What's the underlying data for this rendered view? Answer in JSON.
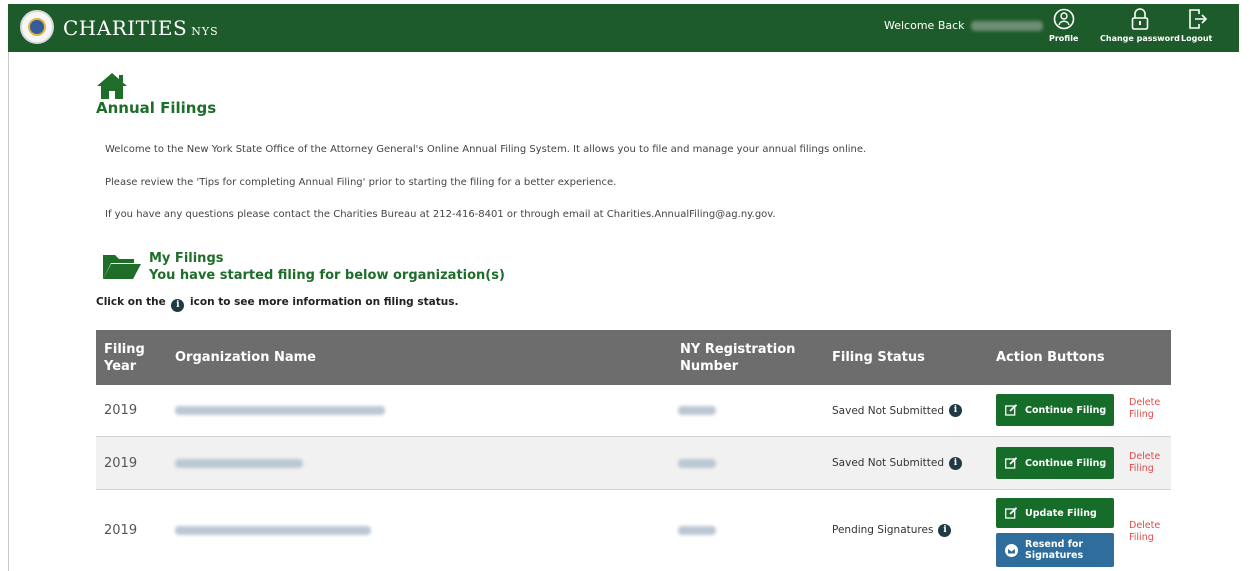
{
  "header": {
    "brand": "CHARITIES",
    "brand_sub": "NYS",
    "welcome": "Welcome Back",
    "nav": [
      {
        "label": "Profile",
        "icon": "profile-icon"
      },
      {
        "label": "Change password",
        "icon": "lock-icon"
      },
      {
        "label": "Logout",
        "icon": "logout-icon"
      }
    ]
  },
  "page": {
    "title": "Annual Filings",
    "paragraphs": [
      "Welcome to the New York State Office of the Attorney General's Online Annual Filing System. It allows you to file and manage your annual filings online.",
      "Please review the 'Tips for completing Annual Filing' prior to starting the filing for a better experience.",
      "If you have any questions please contact the Charities Bureau at 212-416-8401 or through email at Charities.AnnualFiling@ag.ny.gov."
    ]
  },
  "filings": {
    "heading": "My Filings",
    "subheading": "You have started filing for below organization(s)",
    "info_prefix": "Click on the",
    "info_suffix": "icon to see more information on filing status."
  },
  "table": {
    "columns": {
      "year": "Filing Year",
      "org": "Organization Name",
      "regnum": "NY Registration Number",
      "status": "Filing Status",
      "actions": "Action Buttons"
    },
    "rows": [
      {
        "year": "2019",
        "status": "Saved Not Submitted",
        "primary": "Continue Filing",
        "delete": "Delete Filing"
      },
      {
        "year": "2019",
        "status": "Saved Not Submitted",
        "primary": "Continue Filing",
        "delete": "Delete Filing"
      },
      {
        "year": "2019",
        "status": "Pending Signatures",
        "primary": "Update Filing",
        "secondary": "Resend for Signatures",
        "delete": "Delete Filing"
      }
    ]
  },
  "colors": {
    "header_bg": "#1e5b2a",
    "accent_green": "#1e6e2a",
    "button_green": "#166d29",
    "button_blue": "#2e6d9c",
    "table_header": "#6d6d6d",
    "delete_red": "#e24a4a"
  }
}
